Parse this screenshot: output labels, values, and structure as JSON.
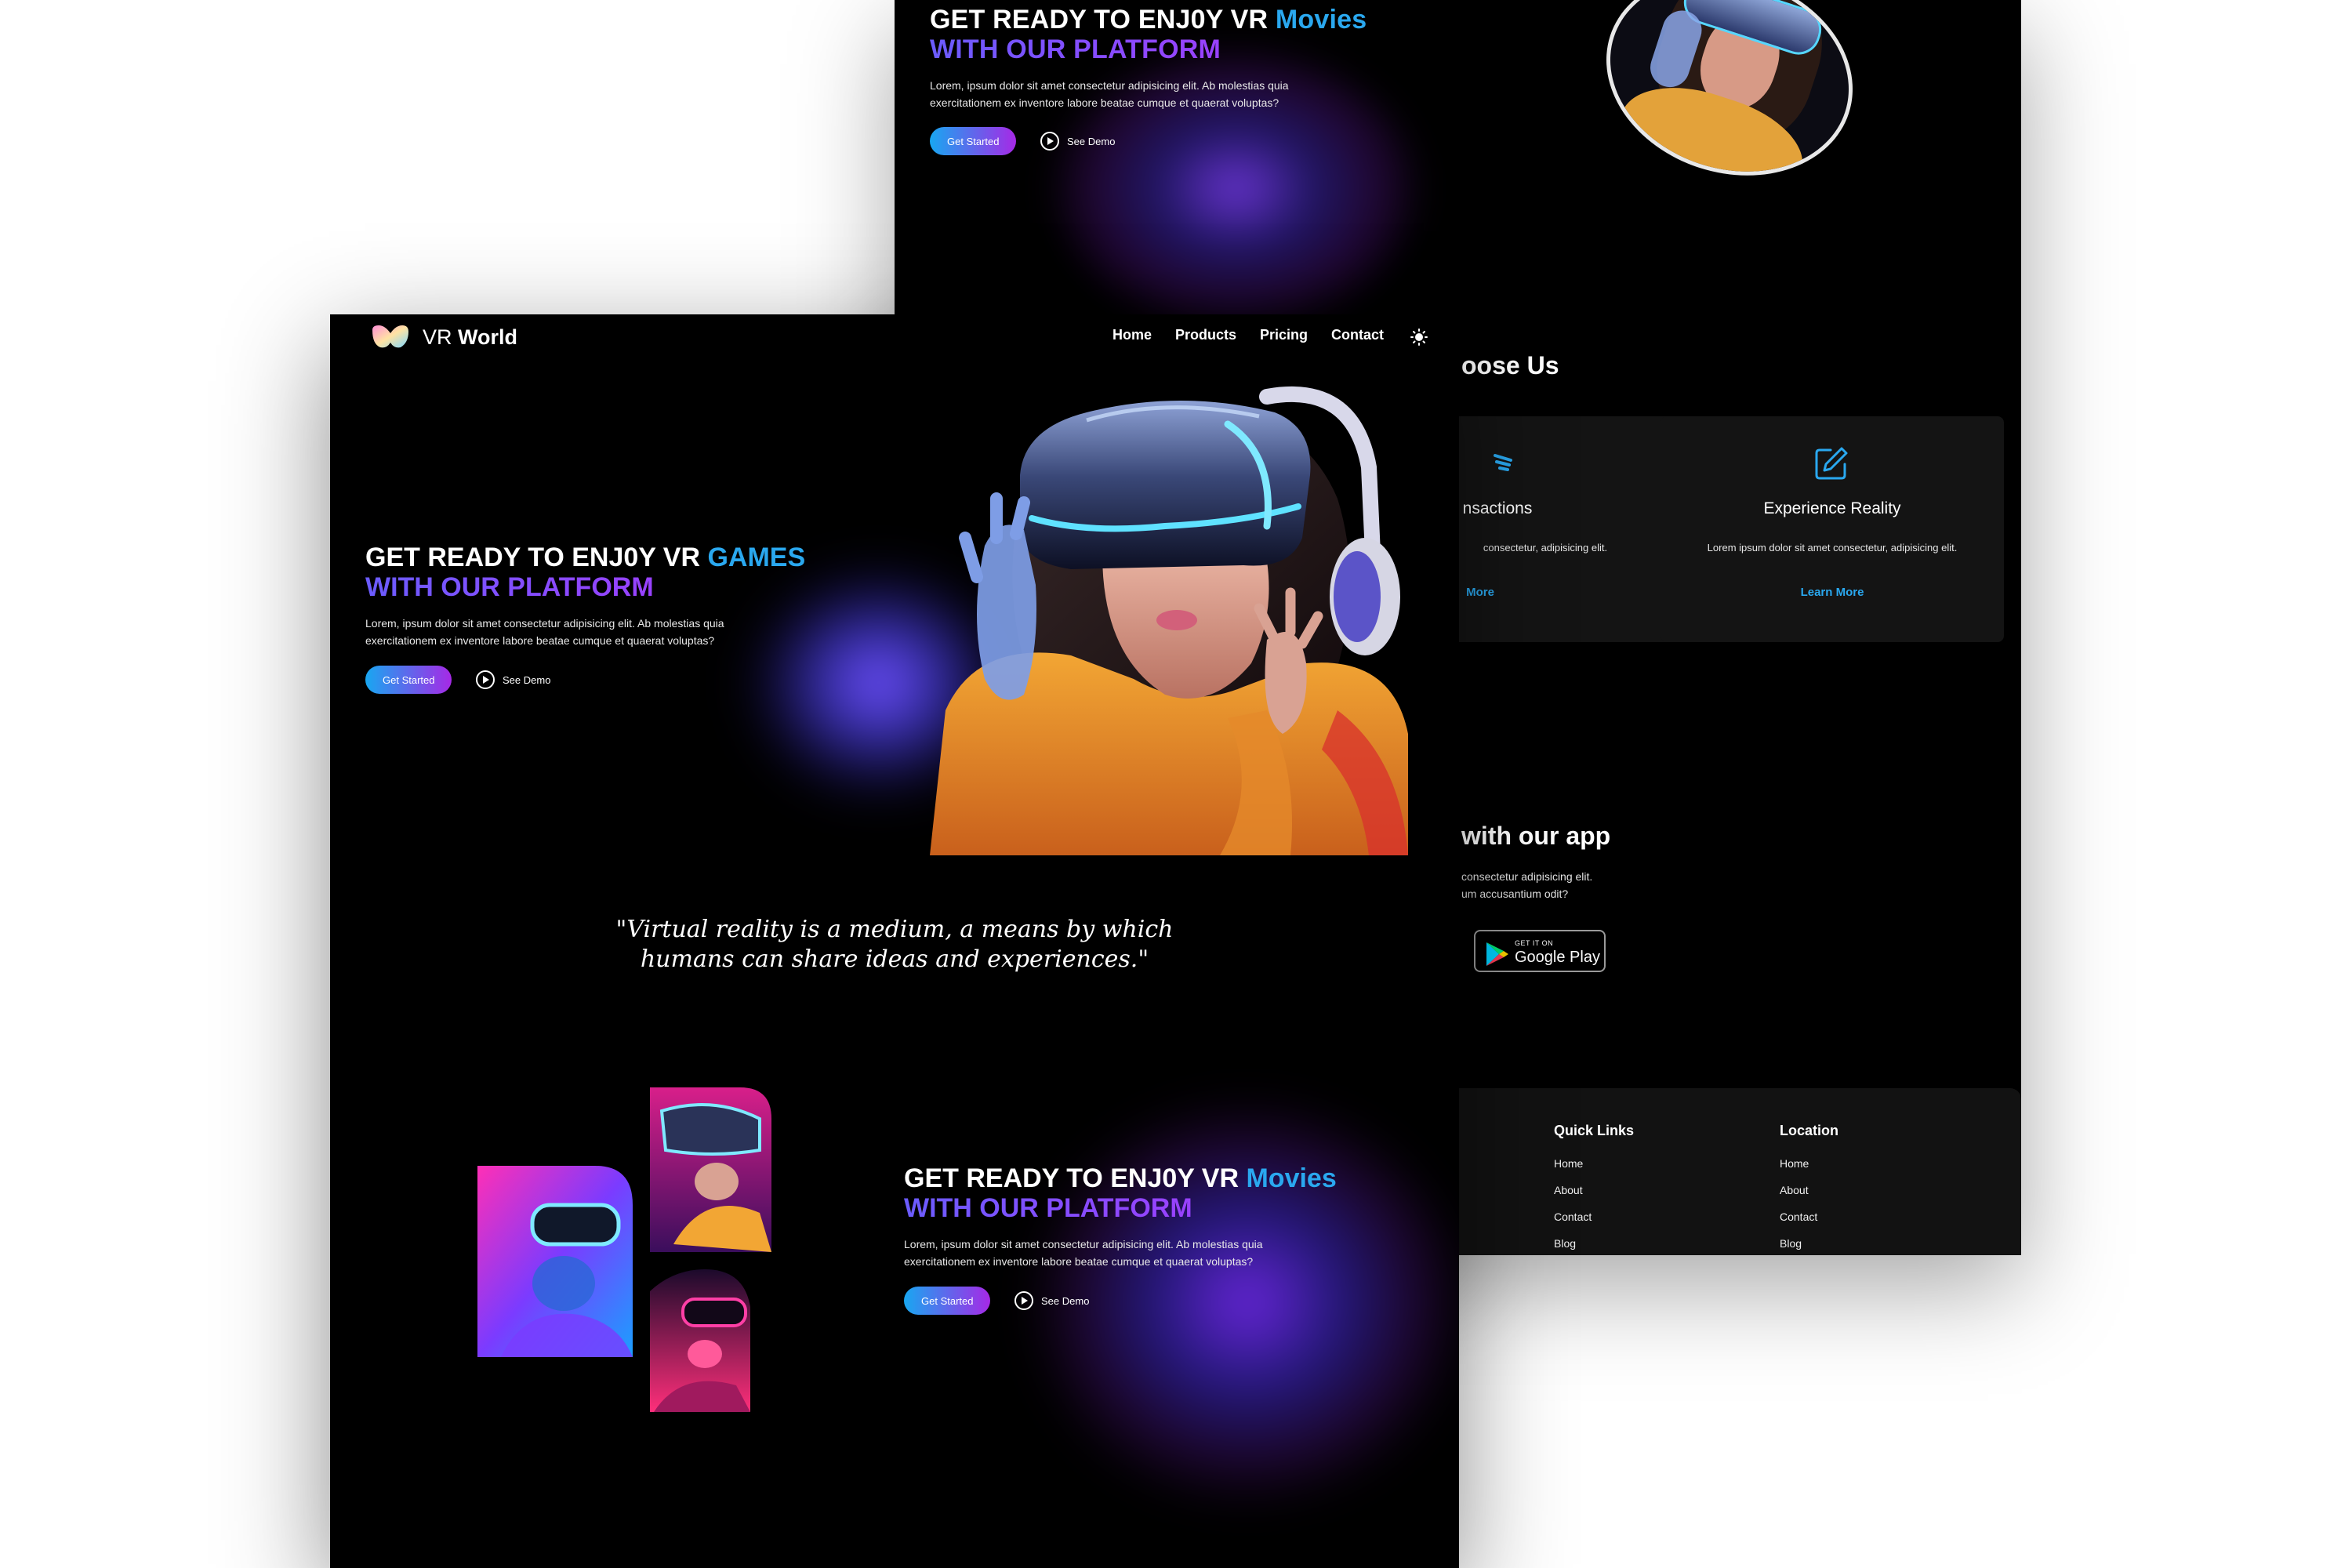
{
  "back_page": {
    "hero": {
      "title_line1": "GET READY TO ENJ0Y VR",
      "title_highlight": "Movies",
      "title_line2": "WITH OUR PLATFORM",
      "description_line1": "Lorem, ipsum dolor sit amet consectetur adipisicing elit. Ab molestias quia",
      "description_line2": "exercitationem ex inventore labore beatae cumque et quaerat voluptas?",
      "cta": "Get Started",
      "demo": "See Demo"
    },
    "why": {
      "title": "oose Us",
      "cards": [
        {
          "title": "nsactions",
          "desc": "consectetur, adipisicing elit.",
          "more": "More"
        },
        {
          "title": "Experience Reality",
          "desc": "Lorem ipsum dolor sit amet consectetur, adipisicing elit.",
          "more": "Learn More"
        }
      ]
    },
    "app": {
      "title": "with our app",
      "desc_line1": "consectetur adipisicing elit.",
      "desc_line2": "um accusantium odit?",
      "store_small": "GET IT ON",
      "store_big": "Google Play"
    },
    "footer": {
      "columns": [
        {
          "head": "Quick Links",
          "links": [
            "Home",
            "About",
            "Contact",
            "Blog"
          ]
        },
        {
          "head": "Location",
          "links": [
            "Home",
            "About",
            "Contact",
            "Blog"
          ]
        }
      ]
    }
  },
  "front_page": {
    "brand": {
      "prefix": "VR",
      "name": "World"
    },
    "nav": [
      "Home",
      "Products",
      "Pricing",
      "Contact"
    ],
    "hero": {
      "title_line1": "GET READY TO ENJ0Y VR",
      "title_highlight": "GAMES",
      "title_line2": "WITH OUR PLATFORM",
      "description_line1": "Lorem, ipsum dolor sit amet consectetur adipisicing elit. Ab molestias quia",
      "description_line2": "exercitationem ex inventore labore beatae cumque et quaerat voluptas?",
      "cta": "Get Started",
      "demo": "See Demo"
    },
    "quote_line1": "\"Virtual reality is a medium, a means by which",
    "quote_line2": "humans can share ideas and experiences.\"",
    "movies": {
      "title_line1": "GET READY TO ENJ0Y VR",
      "title_highlight": "Movies",
      "title_line2": "WITH OUR PLATFORM",
      "description_line1": "Lorem, ipsum dolor sit amet consectetur adipisicing elit. Ab molestias quia",
      "description_line2": "exercitationem ex inventore labore beatae cumque et quaerat voluptas?",
      "cta": "Get Started",
      "demo": "See Demo"
    }
  },
  "colors": {
    "accent_blue": "#2aa8ef",
    "accent_purple": "#a629e6",
    "background": "#000000",
    "card": "#141414"
  },
  "icons": [
    "logo-icon",
    "sun-icon",
    "play-icon",
    "edit-icon",
    "google-play-icon"
  ]
}
